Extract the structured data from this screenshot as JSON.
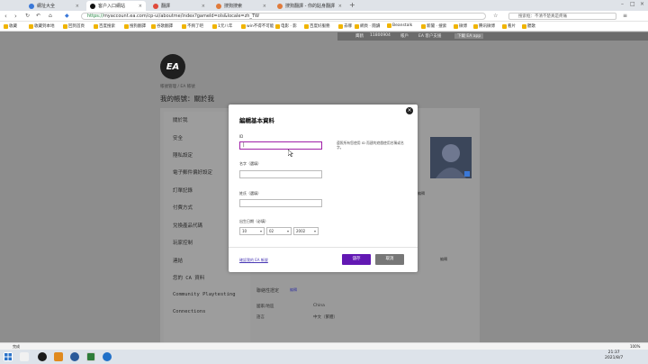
{
  "browser": {
    "tabs": [
      {
        "label": "網址大全",
        "color": "#3a78d8"
      },
      {
        "label": "客户入口網站",
        "color": "#111111",
        "active": true
      },
      {
        "label": "翻譯",
        "color": "#e04a3a"
      },
      {
        "label": "搜狗搜索",
        "color": "#e07a3a"
      },
      {
        "label": "搜狗翻譯 - 你的貼身翻譯",
        "color": "#e07a3a"
      }
    ],
    "url_scheme": "https://",
    "url_rest": "myaccount.ea.com/cp-ui/aboutme/index?gameId=ols&locale=zh_TW",
    "search_placeholder": "搜索框：不清不楚真是疼痛",
    "bookmarks": [
      "收藏",
      "收藏到本地",
      "回到首頁",
      "百度搜索",
      "搜狗翻譯",
      "谷歌翻譯",
      "不夠了吧",
      "1元八年",
      "win不得不可能",
      "电影 · 影",
      "百度好服務",
      "去哪",
      "網頁 · 閱讀",
      "Beanstalk",
      "新聞 · 搜索",
      "微博",
      "腾讯微博",
      "看片",
      "聽歌"
    ]
  },
  "ea_header": {
    "items": [
      "鹰鹤",
      "11800904",
      "帳戶",
      "EA 客户支援",
      "下載 EA app"
    ]
  },
  "breadcrumb": "帳號管理 / EA 帳號",
  "page_title": "我的帳號：關於我",
  "menu": [
    "關於我",
    "安全",
    "隱私設定",
    "電子郵件偏好設定",
    "訂單記錄",
    "付費方式",
    "兌換產品代碼",
    "玩家控制",
    "連結",
    "您的 CA 資料",
    "Community Playtesting",
    "Connections"
  ],
  "background_labels": {
    "availability": "聯絡性證定",
    "edit": "編輯",
    "right_edit": "編輯",
    "country": "國家/地區",
    "country_value": "China",
    "language": "語言",
    "language_value": "中文（繁體）"
  },
  "modal": {
    "title": "編輯基本資料",
    "field_id_label": "ID",
    "field_id_value": "|",
    "id_hint": "遵照所有您使用 ID 而建的遊戲使用名稱或名字。",
    "first_name_label": "名字（選填）",
    "last_name_label": "姓氏（選填）",
    "dob_label": "出生日期（必填）",
    "dob_month": "10",
    "dob_day": "02",
    "dob_year": "2002",
    "link_text": "確認我的 EA 帳號",
    "save_label": "儲存",
    "cancel_label": "取消"
  },
  "statusbar": {
    "left": "完成",
    "zoom": "100%"
  },
  "clock": {
    "time": "21:37",
    "date": "2021/8/7"
  }
}
